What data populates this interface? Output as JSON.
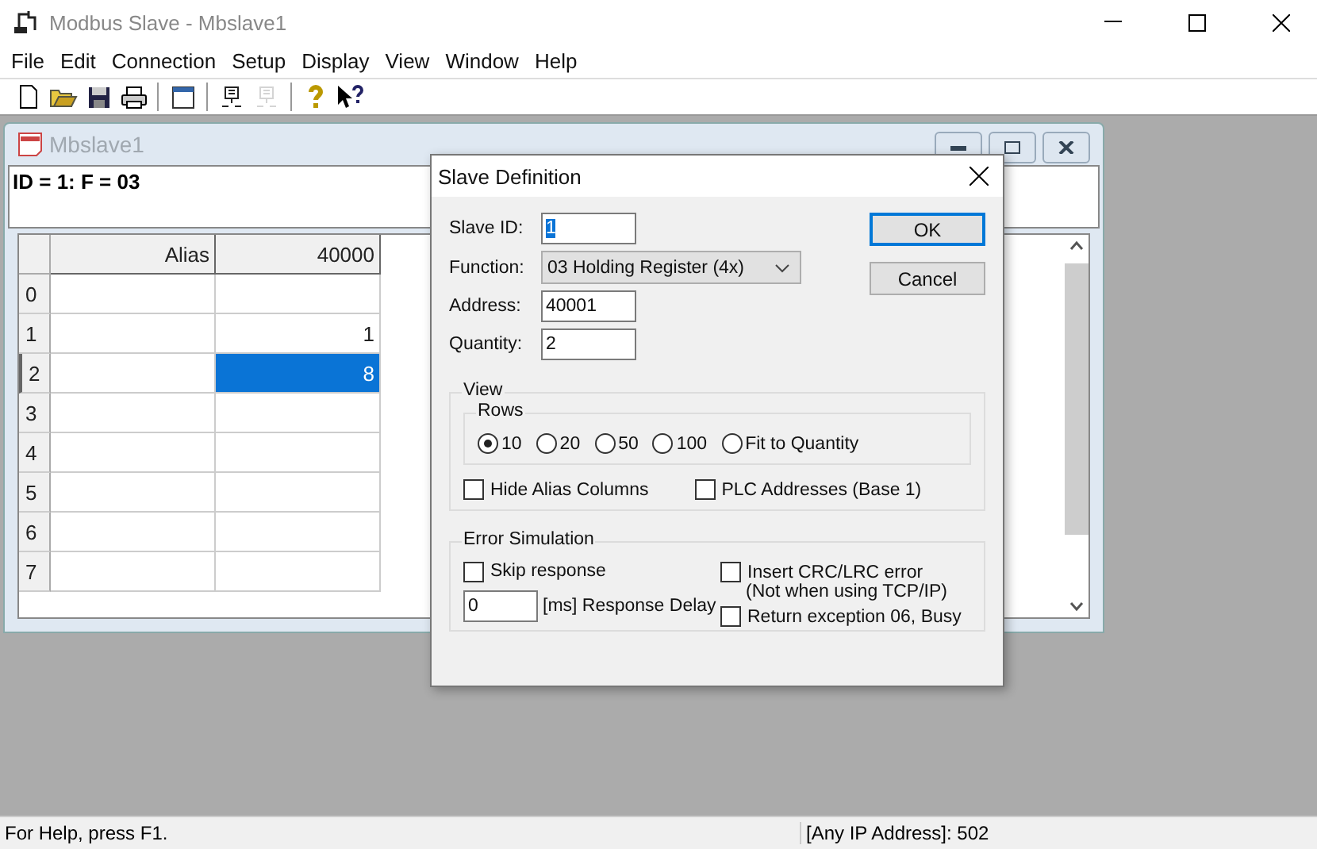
{
  "window": {
    "title": "Modbus Slave - Mbslave1"
  },
  "menu": [
    "File",
    "Edit",
    "Connection",
    "Setup",
    "Display",
    "View",
    "Window",
    "Help"
  ],
  "toolbar": [
    {
      "disabled": false
    },
    {
      "disabled": false
    },
    {
      "disabled": false
    },
    {
      "disabled": false
    },
    {
      "disabled": false
    },
    {
      "disabled": false
    },
    {
      "disabled": true
    },
    {
      "disabled": false
    },
    {
      "disabled": false
    }
  ],
  "child_window": {
    "title": "Mbslave1",
    "info": "ID = 1: F = 03",
    "columns": [
      "Alias",
      "40000"
    ],
    "rows": [
      {
        "header": "0",
        "selected": false
      },
      {
        "header": "1",
        "value": "1",
        "selected": false
      },
      {
        "header": "2",
        "value": "8",
        "selected": true
      },
      {
        "header": "3",
        "selected": false
      },
      {
        "header": "4",
        "selected": false
      },
      {
        "header": "5",
        "selected": false
      },
      {
        "header": "6",
        "selected": false
      },
      {
        "header": "7",
        "selected": false
      }
    ]
  },
  "dialog": {
    "title": "Slave Definition",
    "fields": [
      {
        "label": "Slave ID:",
        "kind": "text",
        "value": "1",
        "selected_text": true
      },
      {
        "label": "Function:",
        "kind": "dropdown",
        "value": "03 Holding Register (4x)"
      },
      {
        "label": "Address:",
        "kind": "text",
        "value": "40001",
        "selected_text": false
      },
      {
        "label": "Quantity:",
        "kind": "text",
        "value": "2",
        "selected_text": false
      }
    ],
    "buttons": [
      {
        "label": "OK",
        "default": true
      },
      {
        "label": "Cancel",
        "default": false
      }
    ],
    "view": {
      "title": "View",
      "rows": {
        "title": "Rows",
        "options": [
          {
            "label": "10",
            "selected": true
          },
          {
            "label": "20",
            "selected": false
          },
          {
            "label": "50",
            "selected": false
          },
          {
            "label": "100",
            "selected": false
          },
          {
            "label": "Fit to Quantity",
            "selected": false
          }
        ]
      },
      "checkboxes": [
        {
          "label": "Hide Alias Columns",
          "checked": false
        },
        {
          "label": "PLC Addresses (Base 1)",
          "checked": false
        }
      ]
    },
    "error_simulation": {
      "title": "Error Simulation",
      "skip_response": {
        "label": "Skip response",
        "checked": false
      },
      "delay": {
        "value": "0",
        "label": "[ms] Response Delay"
      },
      "insert_crc": {
        "label": "Insert CRC/LRC error",
        "note": "(Not when using TCP/IP)",
        "checked": false
      },
      "return_exception": {
        "label": "Return exception 06, Busy",
        "checked": false
      }
    }
  },
  "status_bar": {
    "help": "For Help, press F1.",
    "connection": "[Any IP Address]: 502"
  }
}
